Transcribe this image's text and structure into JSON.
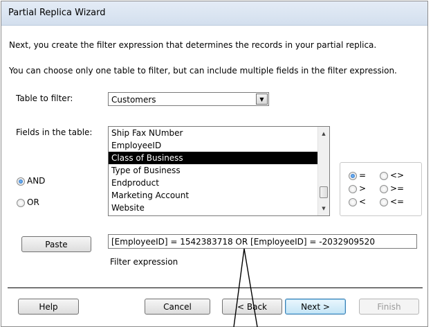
{
  "title": "Partial Replica Wizard",
  "intro_line1": "Next, you create the filter expression that determines the records in your partial replica.",
  "intro_line2": "You can choose only one table to filter, but can include multiple fields in the filter expression.",
  "table_to_filter": {
    "label": "Table to filter:",
    "value": "Customers"
  },
  "fields": {
    "label": "Fields in the table:",
    "items": [
      "Ship Fax NUmber",
      "EmployeeID",
      "Class of Business",
      "Type of Business",
      "Endproduct",
      "Marketing Account",
      "Website"
    ],
    "selected": "Class of Business"
  },
  "logic": {
    "and_label": "AND",
    "or_label": "OR",
    "selected": "AND"
  },
  "operators": {
    "items": [
      "=",
      "<>",
      ">",
      ">=",
      "<",
      "<="
    ],
    "selected": "="
  },
  "paste_label": "Paste",
  "filter_expression": {
    "value": "[EmployeeID] = 1542383718 OR [EmployeeID] = -2032909520",
    "label": "Filter expression"
  },
  "buttons": {
    "help": "Help",
    "cancel": "Cancel",
    "back": "< Back",
    "next": "Next >",
    "finish": "Finish"
  }
}
